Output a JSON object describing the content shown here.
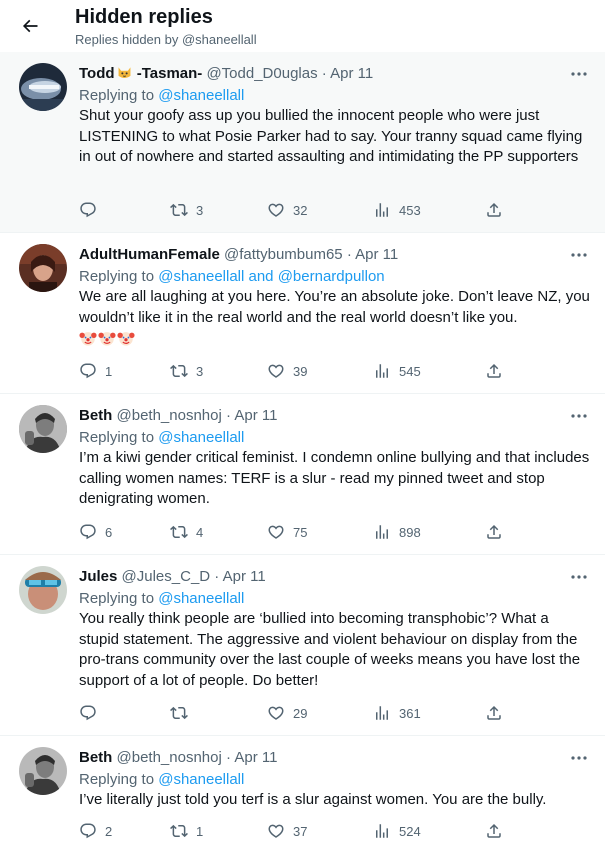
{
  "header": {
    "title": "Hidden replies",
    "subtitle": "Replies hidden by @shaneellall"
  },
  "tweets": [
    {
      "name": "Todd",
      "name_emoji": "cat-emoji",
      "name_suffix": " -Tasman-",
      "handle": "@Todd_D0uglas",
      "date": "Apr 11",
      "replying_label": "Replying to ",
      "replying_to": "@shaneellall",
      "text": "Shut your goofy ass up you bullied the innocent people who were just LISTENING to what Posie Parker had to say. Your tranny squad came flying in out of nowhere and started assaulting and intimidating the PP supporters",
      "replies": "",
      "retweets": "3",
      "likes": "32",
      "views": "453"
    },
    {
      "name": "AdultHumanFemale",
      "handle": "@fattybumbum65",
      "date": "Apr 11",
      "replying_label": "Replying to ",
      "replying_to": "@shaneellall and @bernardpullon",
      "text": "We are all laughing at you here. You’re an absolute joke. Don’t leave NZ, you wouldn’t like it in the real world and the real world doesn’t like you.",
      "text_emojis": [
        "clown-face-emoji",
        "clown-face-emoji",
        "clown-face-emoji"
      ],
      "replies": "1",
      "retweets": "3",
      "likes": "39",
      "views": "545"
    },
    {
      "name": "Beth",
      "handle": "@beth_nosnhoj",
      "date": "Apr 11",
      "replying_label": "Replying to ",
      "replying_to": "@shaneellall",
      "text": "I’m a kiwi gender critical feminist. I condemn online bullying and that includes calling women names: TERF is a slur - read my pinned tweet and stop denigrating women.",
      "replies": "6",
      "retweets": "4",
      "likes": "75",
      "views": "898"
    },
    {
      "name": "Jules",
      "handle": "@Jules_C_D",
      "date": "Apr 11",
      "replying_label": "Replying to ",
      "replying_to": "@shaneellall",
      "text": "You really think people are ‘bullied into becoming transphobic’? What a stupid statement. The aggressive and violent behaviour on display from the pro-trans community over the last couple of weeks means you have lost the support of a lot of people. Do better!",
      "replies": "",
      "retweets": "",
      "likes": "29",
      "views": "361"
    },
    {
      "name": "Beth",
      "handle": "@beth_nosnhoj",
      "date": "Apr 11",
      "replying_label": "Replying to ",
      "replying_to": "@shaneellall",
      "text": "I’ve literally just told you terf is a slur against women. You are the bully.",
      "replies": "2",
      "retweets": "1",
      "likes": "37",
      "views": "524"
    }
  ],
  "separator_dot": "·",
  "colors": {
    "link": "#1d9bf0",
    "secondary_text": "#536471",
    "primary_text": "#0f1419",
    "highlight_bg": "#f7f9f9"
  }
}
